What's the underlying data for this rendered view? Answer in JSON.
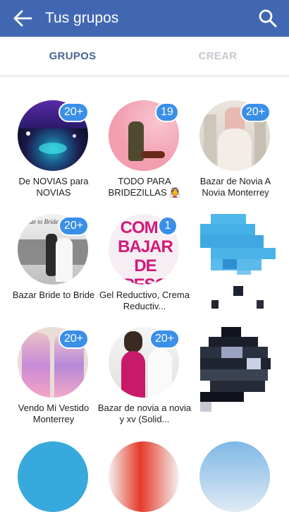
{
  "appbar": {
    "title": "Tus grupos",
    "back_icon": "arrow-left-icon",
    "search_icon": "search-icon",
    "color": "#4267b2"
  },
  "tabs": [
    {
      "label": "GRUPOS",
      "active": true
    },
    {
      "label": "CREAR",
      "active": false
    }
  ],
  "groups": [
    {
      "name": "De NOVIAS para NOVIAS",
      "badge": "20+"
    },
    {
      "name": "TODO PARA BRIDEZILLAS 👰 ",
      "badge": "19"
    },
    {
      "name": "Bazar de Novia A Novia Monterrey",
      "badge": "20+"
    },
    {
      "name": "Bazar Bride to Bride",
      "badge": "20+",
      "photo_text": "Bride to Bride"
    },
    {
      "name": "Gel Reductivo, Crema Reductiv...",
      "badge": "1",
      "photo_text": "COMO BAJAR DE PESO"
    },
    {
      "name": "",
      "badge": ""
    },
    {
      "name": "Vendo Mi Vestido Monterrey",
      "badge": "20+"
    },
    {
      "name": "Bazar de novia a novia y xv (Solid...",
      "badge": "20+"
    },
    {
      "name": "",
      "badge": ""
    }
  ]
}
